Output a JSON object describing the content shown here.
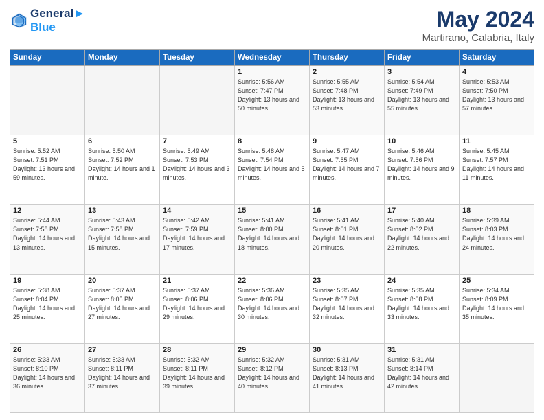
{
  "header": {
    "logo_line1": "General",
    "logo_line2": "Blue",
    "title": "May 2024",
    "subtitle": "Martirano, Calabria, Italy"
  },
  "weekdays": [
    "Sunday",
    "Monday",
    "Tuesday",
    "Wednesday",
    "Thursday",
    "Friday",
    "Saturday"
  ],
  "weeks": [
    [
      {
        "day": "",
        "sunrise": "",
        "sunset": "",
        "daylight": ""
      },
      {
        "day": "",
        "sunrise": "",
        "sunset": "",
        "daylight": ""
      },
      {
        "day": "",
        "sunrise": "",
        "sunset": "",
        "daylight": ""
      },
      {
        "day": "1",
        "sunrise": "Sunrise: 5:56 AM",
        "sunset": "Sunset: 7:47 PM",
        "daylight": "Daylight: 13 hours and 50 minutes."
      },
      {
        "day": "2",
        "sunrise": "Sunrise: 5:55 AM",
        "sunset": "Sunset: 7:48 PM",
        "daylight": "Daylight: 13 hours and 53 minutes."
      },
      {
        "day": "3",
        "sunrise": "Sunrise: 5:54 AM",
        "sunset": "Sunset: 7:49 PM",
        "daylight": "Daylight: 13 hours and 55 minutes."
      },
      {
        "day": "4",
        "sunrise": "Sunrise: 5:53 AM",
        "sunset": "Sunset: 7:50 PM",
        "daylight": "Daylight: 13 hours and 57 minutes."
      }
    ],
    [
      {
        "day": "5",
        "sunrise": "Sunrise: 5:52 AM",
        "sunset": "Sunset: 7:51 PM",
        "daylight": "Daylight: 13 hours and 59 minutes."
      },
      {
        "day": "6",
        "sunrise": "Sunrise: 5:50 AM",
        "sunset": "Sunset: 7:52 PM",
        "daylight": "Daylight: 14 hours and 1 minute."
      },
      {
        "day": "7",
        "sunrise": "Sunrise: 5:49 AM",
        "sunset": "Sunset: 7:53 PM",
        "daylight": "Daylight: 14 hours and 3 minutes."
      },
      {
        "day": "8",
        "sunrise": "Sunrise: 5:48 AM",
        "sunset": "Sunset: 7:54 PM",
        "daylight": "Daylight: 14 hours and 5 minutes."
      },
      {
        "day": "9",
        "sunrise": "Sunrise: 5:47 AM",
        "sunset": "Sunset: 7:55 PM",
        "daylight": "Daylight: 14 hours and 7 minutes."
      },
      {
        "day": "10",
        "sunrise": "Sunrise: 5:46 AM",
        "sunset": "Sunset: 7:56 PM",
        "daylight": "Daylight: 14 hours and 9 minutes."
      },
      {
        "day": "11",
        "sunrise": "Sunrise: 5:45 AM",
        "sunset": "Sunset: 7:57 PM",
        "daylight": "Daylight: 14 hours and 11 minutes."
      }
    ],
    [
      {
        "day": "12",
        "sunrise": "Sunrise: 5:44 AM",
        "sunset": "Sunset: 7:58 PM",
        "daylight": "Daylight: 14 hours and 13 minutes."
      },
      {
        "day": "13",
        "sunrise": "Sunrise: 5:43 AM",
        "sunset": "Sunset: 7:58 PM",
        "daylight": "Daylight: 14 hours and 15 minutes."
      },
      {
        "day": "14",
        "sunrise": "Sunrise: 5:42 AM",
        "sunset": "Sunset: 7:59 PM",
        "daylight": "Daylight: 14 hours and 17 minutes."
      },
      {
        "day": "15",
        "sunrise": "Sunrise: 5:41 AM",
        "sunset": "Sunset: 8:00 PM",
        "daylight": "Daylight: 14 hours and 18 minutes."
      },
      {
        "day": "16",
        "sunrise": "Sunrise: 5:41 AM",
        "sunset": "Sunset: 8:01 PM",
        "daylight": "Daylight: 14 hours and 20 minutes."
      },
      {
        "day": "17",
        "sunrise": "Sunrise: 5:40 AM",
        "sunset": "Sunset: 8:02 PM",
        "daylight": "Daylight: 14 hours and 22 minutes."
      },
      {
        "day": "18",
        "sunrise": "Sunrise: 5:39 AM",
        "sunset": "Sunset: 8:03 PM",
        "daylight": "Daylight: 14 hours and 24 minutes."
      }
    ],
    [
      {
        "day": "19",
        "sunrise": "Sunrise: 5:38 AM",
        "sunset": "Sunset: 8:04 PM",
        "daylight": "Daylight: 14 hours and 25 minutes."
      },
      {
        "day": "20",
        "sunrise": "Sunrise: 5:37 AM",
        "sunset": "Sunset: 8:05 PM",
        "daylight": "Daylight: 14 hours and 27 minutes."
      },
      {
        "day": "21",
        "sunrise": "Sunrise: 5:37 AM",
        "sunset": "Sunset: 8:06 PM",
        "daylight": "Daylight: 14 hours and 29 minutes."
      },
      {
        "day": "22",
        "sunrise": "Sunrise: 5:36 AM",
        "sunset": "Sunset: 8:06 PM",
        "daylight": "Daylight: 14 hours and 30 minutes."
      },
      {
        "day": "23",
        "sunrise": "Sunrise: 5:35 AM",
        "sunset": "Sunset: 8:07 PM",
        "daylight": "Daylight: 14 hours and 32 minutes."
      },
      {
        "day": "24",
        "sunrise": "Sunrise: 5:35 AM",
        "sunset": "Sunset: 8:08 PM",
        "daylight": "Daylight: 14 hours and 33 minutes."
      },
      {
        "day": "25",
        "sunrise": "Sunrise: 5:34 AM",
        "sunset": "Sunset: 8:09 PM",
        "daylight": "Daylight: 14 hours and 35 minutes."
      }
    ],
    [
      {
        "day": "26",
        "sunrise": "Sunrise: 5:33 AM",
        "sunset": "Sunset: 8:10 PM",
        "daylight": "Daylight: 14 hours and 36 minutes."
      },
      {
        "day": "27",
        "sunrise": "Sunrise: 5:33 AM",
        "sunset": "Sunset: 8:11 PM",
        "daylight": "Daylight: 14 hours and 37 minutes."
      },
      {
        "day": "28",
        "sunrise": "Sunrise: 5:32 AM",
        "sunset": "Sunset: 8:11 PM",
        "daylight": "Daylight: 14 hours and 39 minutes."
      },
      {
        "day": "29",
        "sunrise": "Sunrise: 5:32 AM",
        "sunset": "Sunset: 8:12 PM",
        "daylight": "Daylight: 14 hours and 40 minutes."
      },
      {
        "day": "30",
        "sunrise": "Sunrise: 5:31 AM",
        "sunset": "Sunset: 8:13 PM",
        "daylight": "Daylight: 14 hours and 41 minutes."
      },
      {
        "day": "31",
        "sunrise": "Sunrise: 5:31 AM",
        "sunset": "Sunset: 8:14 PM",
        "daylight": "Daylight: 14 hours and 42 minutes."
      },
      {
        "day": "",
        "sunrise": "",
        "sunset": "",
        "daylight": ""
      }
    ]
  ]
}
